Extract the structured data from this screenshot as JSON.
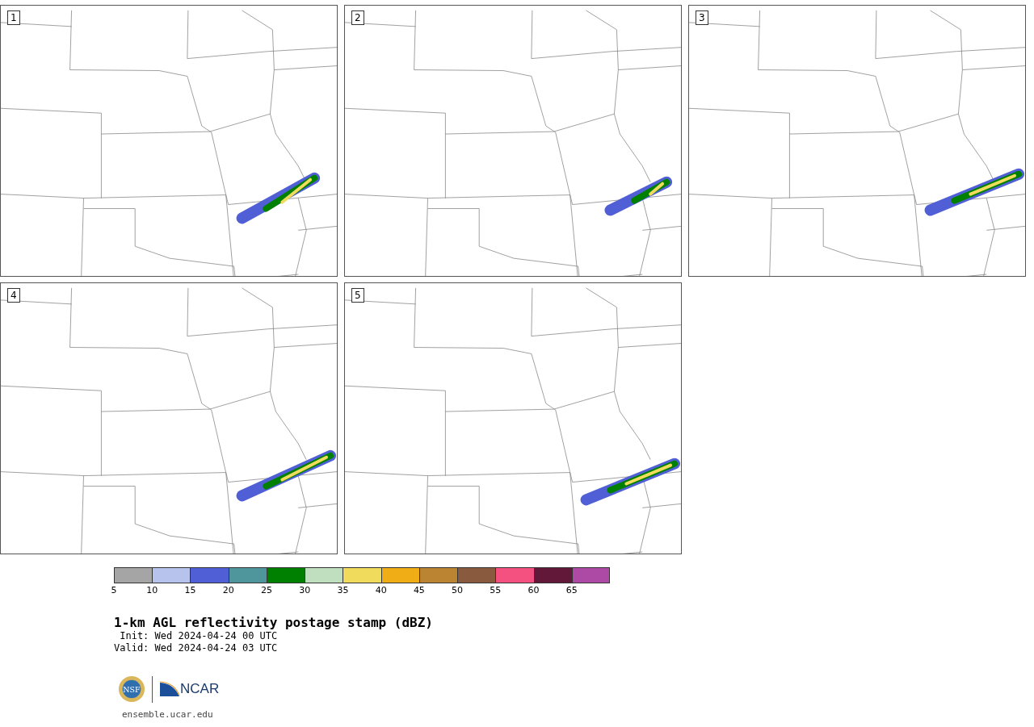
{
  "panels": [
    {
      "label": "1"
    },
    {
      "label": "2"
    },
    {
      "label": "3"
    },
    {
      "label": "4"
    },
    {
      "label": "5"
    }
  ],
  "colorbar": {
    "segments": [
      {
        "color": "#a5a5a5",
        "tick": "5"
      },
      {
        "color": "#b7c3ed",
        "tick": "10"
      },
      {
        "color": "#505fd6",
        "tick": "15"
      },
      {
        "color": "#4f969c",
        "tick": "20"
      },
      {
        "color": "#008000",
        "tick": "25"
      },
      {
        "color": "#bfdfbf",
        "tick": "30"
      },
      {
        "color": "#f0db5d",
        "tick": "35"
      },
      {
        "color": "#f0ad16",
        "tick": "40"
      },
      {
        "color": "#ba8432",
        "tick": "45"
      },
      {
        "color": "#8a5a3f",
        "tick": "50"
      },
      {
        "color": "#f55180",
        "tick": "55"
      },
      {
        "color": "#621838",
        "tick": "60"
      },
      {
        "color": "#ad4aa5",
        "tick": "65"
      }
    ]
  },
  "title": "1-km AGL reflectivity postage stamp (dBZ)",
  "init": " Init: Wed 2024-04-24 00 UTC",
  "valid": "Valid: Wed 2024-04-24 03 UTC",
  "footer": {
    "seal_text": "NSF",
    "org": "NCAR",
    "url": "ensemble.ucar.edu"
  }
}
